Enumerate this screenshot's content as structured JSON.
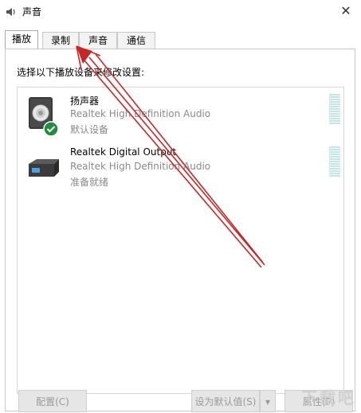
{
  "window": {
    "title": "声音"
  },
  "tabs": [
    {
      "label": "播放"
    },
    {
      "label": "录制"
    },
    {
      "label": "声音"
    },
    {
      "label": "通信"
    }
  ],
  "instruction": "选择以下播放设备来修改设置:",
  "devices": [
    {
      "name": "扬声器",
      "driver": "Realtek High Definition Audio",
      "status": "默认设备"
    },
    {
      "name": "Realtek Digital Output",
      "driver": "Realtek High Definition Audio",
      "status": "准备就绪"
    }
  ],
  "buttons": {
    "configure": "配置(C)",
    "set_default": "设为默认值(S)",
    "properties": "属性(P)"
  },
  "watermark": "下载吧",
  "colors": {
    "annotation_arrow": "#c62828",
    "default_check": "#1e8e3e"
  }
}
